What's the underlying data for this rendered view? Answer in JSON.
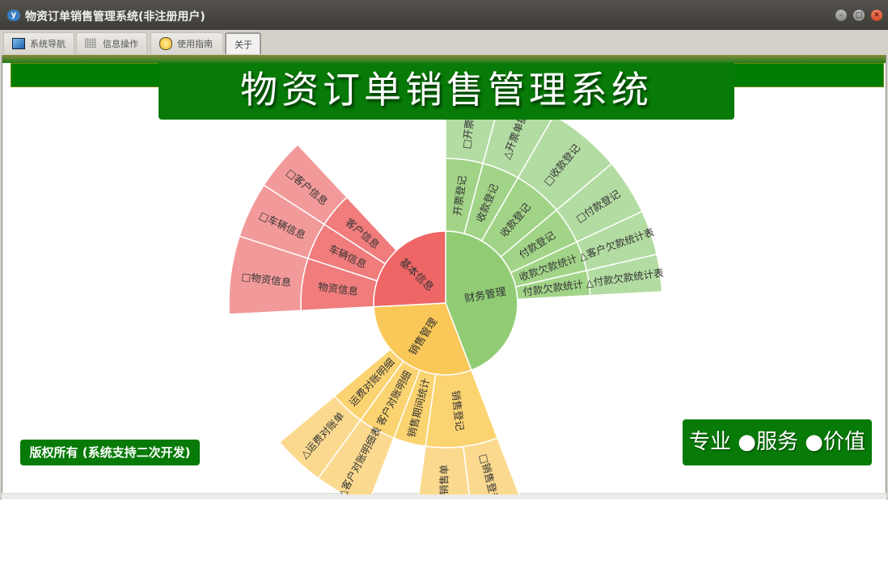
{
  "window": {
    "title": "物资订单销售管理系统(非注册用户)",
    "app_icon_text": "y"
  },
  "tabs": [
    {
      "label": "系统导航",
      "icon": "monitor-icon"
    },
    {
      "label": "信息操作",
      "icon": "grid-icon"
    },
    {
      "label": "使用指南",
      "icon": "help-icon"
    },
    {
      "label": "关于",
      "icon": ""
    }
  ],
  "banner": {
    "title": "物资订单销售管理系统"
  },
  "footer": {
    "copyright": "版权所有 (系统支持二次开发)",
    "slogan": "专业 ●服务 ●价值"
  },
  "colors": {
    "brand_green": "#077a07",
    "red": "#ee6666",
    "green": "#91cc75",
    "yellow": "#fac858"
  },
  "chart_data": {
    "type": "sunburst",
    "nodes": [
      {
        "name": "财务管理",
        "value": 159,
        "color": "#91cc75",
        "children": [
          {
            "name": "开票登记",
            "value": 15,
            "children": [
              {
                "name": "□开票登记",
                "value": 15
              }
            ]
          },
          {
            "name": "收款登记",
            "value": 15,
            "children": [
              {
                "name": "△开票单据",
                "value": 15
              }
            ]
          },
          {
            "name": "收款登记",
            "value": 20,
            "children": [
              {
                "name": "□收款登记",
                "value": 20
              }
            ]
          },
          {
            "name": "付款登记",
            "value": 15,
            "children": [
              {
                "name": "□付款登记",
                "value": 15
              }
            ]
          },
          {
            "name": "收款欠款统计",
            "value": 12,
            "children": [
              {
                "name": "△客户欠款统计表",
                "value": 12
              }
            ]
          },
          {
            "name": "付款欠款统计",
            "value": 10,
            "children": [
              {
                "name": "△付款欠款统计表",
                "value": 10
              }
            ]
          }
        ]
      },
      {
        "name": "销售管理",
        "value": 108,
        "color": "#fac858",
        "children": [
          {
            "name": "销售登记",
            "value": 29,
            "children": [
              {
                "name": "□销售登记",
                "value": 14
              },
              {
                "name": "△销售单",
                "value": 15
              }
            ]
          },
          {
            "name": "销售期间统计",
            "value": 13,
            "children": []
          },
          {
            "name": "客户对账明细",
            "value": 15,
            "children": [
              {
                "name": "△客户对账明细表",
                "value": 15
              }
            ]
          },
          {
            "name": "运费对账明细",
            "value": 14,
            "children": [
              {
                "name": "△运费对账单",
                "value": 14
              }
            ]
          }
        ]
      },
      {
        "name": "基本信息",
        "value": 93,
        "color": "#ee6666",
        "children": [
          {
            "name": "物资信息",
            "value": 21,
            "children": [
              {
                "name": "□物资信息",
                "value": 21
              }
            ]
          },
          {
            "name": "车辆信息",
            "value": 15,
            "children": [
              {
                "name": "□车辆信息",
                "value": 15
              }
            ]
          },
          {
            "name": "客户信息",
            "value": 14,
            "children": [
              {
                "name": "□客户信息",
                "value": 14
              }
            ]
          }
        ]
      }
    ]
  }
}
